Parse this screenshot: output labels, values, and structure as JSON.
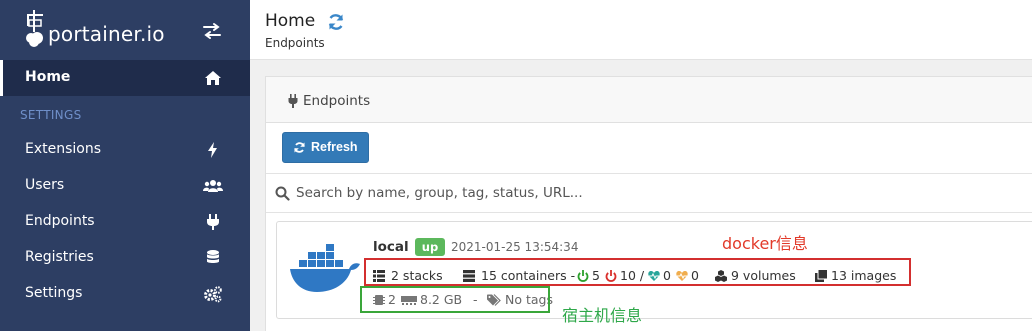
{
  "brand": {
    "name": "portainer.io"
  },
  "sidebar": {
    "home": "Home",
    "section": "SETTINGS",
    "items": [
      {
        "label": "Extensions",
        "icon": "bolt-icon"
      },
      {
        "label": "Users",
        "icon": "users-icon"
      },
      {
        "label": "Endpoints",
        "icon": "plug-icon"
      },
      {
        "label": "Registries",
        "icon": "database-icon"
      },
      {
        "label": "Settings",
        "icon": "cogs-icon"
      }
    ]
  },
  "header": {
    "title": "Home",
    "breadcrumb": "Endpoints"
  },
  "panel": {
    "title": "Endpoints",
    "refresh_label": "Refresh",
    "search_placeholder": "Search by name, group, tag, status, URL..."
  },
  "endpoint": {
    "name": "local",
    "status": "up",
    "timestamp": "2021-01-25 13:54:34",
    "stacks": "2 stacks",
    "containers": "15 containers -",
    "running": "5",
    "stopped": "10 /",
    "healthy": "0",
    "unhealthy": "0",
    "volumes": "9 volumes",
    "images": "13 images",
    "cpu": "2",
    "memory": "8.2 GB",
    "separator": "-",
    "tags": "No tags"
  },
  "annotations": {
    "docker_info": "docker信息",
    "host_info": "宿主机信息"
  },
  "colors": {
    "sidebar": "#2d3e63",
    "sidebar_active": "#1f2c4b",
    "primary_button": "#337ab7",
    "status_up": "#5cb85c",
    "annotation_red": "#d32f2f",
    "annotation_green": "#3aa63a"
  }
}
